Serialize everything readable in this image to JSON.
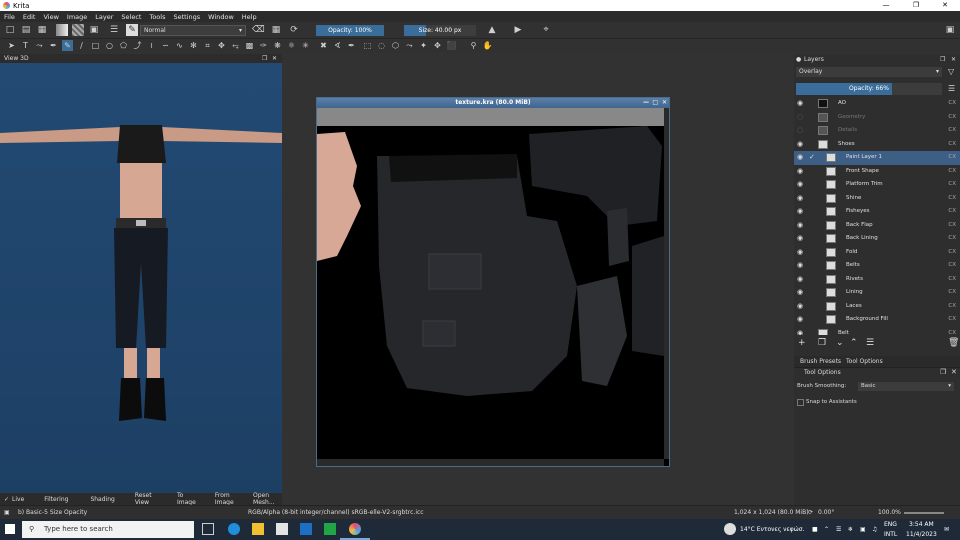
{
  "window": {
    "title": "Krita"
  },
  "menubar": [
    "File",
    "Edit",
    "View",
    "Image",
    "Layer",
    "Select",
    "Tools",
    "Settings",
    "Window",
    "Help"
  ],
  "toolbar": {
    "blend_mode": "Normal",
    "opacity_label": "Opacity: 100%",
    "opacity_value": 100,
    "size_label": "Size: 40.00 px",
    "size_fraction": 0.3
  },
  "view3d": {
    "title": "View 3D",
    "buttons": [
      "Live",
      "Filtering",
      "Shading",
      "Reset View",
      "To Image",
      "From Image",
      "Open Mesh..."
    ]
  },
  "document": {
    "title": "texture.kra (80.0 MiB)"
  },
  "layers": {
    "title": "Layers",
    "blend_mode": "Overlay",
    "opacity_label": "Opacity: 66%",
    "opacity_value": 66,
    "items": [
      {
        "name": "AO",
        "visible": true,
        "selected": false,
        "indent": 0,
        "thumb": "dark"
      },
      {
        "name": "Geometry",
        "visible": false,
        "selected": false,
        "indent": 0,
        "thumb": "gray"
      },
      {
        "name": "Details",
        "visible": false,
        "selected": false,
        "indent": 0,
        "thumb": "gray"
      },
      {
        "name": "Shoes",
        "visible": true,
        "selected": false,
        "indent": 0,
        "thumb": "light"
      },
      {
        "name": "Paint Layer 1",
        "visible": true,
        "selected": true,
        "indent": 1,
        "thumb": "light"
      },
      {
        "name": "Front Shape",
        "visible": true,
        "selected": false,
        "indent": 1,
        "thumb": "light"
      },
      {
        "name": "Platform Trim",
        "visible": true,
        "selected": false,
        "indent": 1,
        "thumb": "light"
      },
      {
        "name": "Shine",
        "visible": true,
        "selected": false,
        "indent": 1,
        "thumb": "light"
      },
      {
        "name": "Fisheyes",
        "visible": true,
        "selected": false,
        "indent": 1,
        "thumb": "light"
      },
      {
        "name": "Back Flap",
        "visible": true,
        "selected": false,
        "indent": 1,
        "thumb": "light"
      },
      {
        "name": "Back Lining",
        "visible": true,
        "selected": false,
        "indent": 1,
        "thumb": "light"
      },
      {
        "name": "Fold",
        "visible": true,
        "selected": false,
        "indent": 1,
        "thumb": "light"
      },
      {
        "name": "Belts",
        "visible": true,
        "selected": false,
        "indent": 1,
        "thumb": "light"
      },
      {
        "name": "Rivets",
        "visible": true,
        "selected": false,
        "indent": 1,
        "thumb": "light"
      },
      {
        "name": "Lining",
        "visible": true,
        "selected": false,
        "indent": 1,
        "thumb": "light"
      },
      {
        "name": "Laces",
        "visible": true,
        "selected": false,
        "indent": 1,
        "thumb": "light"
      },
      {
        "name": "Background Fill",
        "visible": true,
        "selected": false,
        "indent": 1,
        "thumb": "light"
      },
      {
        "name": "Belt",
        "visible": true,
        "selected": false,
        "indent": 0,
        "thumb": "light"
      }
    ],
    "props_label": "CX"
  },
  "panel_tabs": [
    "Brush Presets",
    "Tool Options"
  ],
  "tool_options": {
    "title": "Tool Options",
    "smoothing_label": "Brush Smoothing:",
    "smoothing_value": "Basic",
    "snap_label": "Snap to Assistants"
  },
  "statusbar": {
    "brush": "b) Basic-5 Size Opacity",
    "color_info": "RGB/Alpha (8-bit integer/channel)  sRGB-elle-V2-srgbtrc.icc",
    "dimensions": "1,024 x 1,024 (80.0 MiB)",
    "rotation": "0.00°",
    "zoom": "100.0%"
  },
  "taskbar": {
    "search_placeholder": "Type here to search",
    "weather": "14°C  Εντονες νεφώσ.",
    "lang": "ENG",
    "lang2": "INTL",
    "time": "3:54 AM",
    "date": "11/4/2023"
  },
  "colors": {
    "accent": "#3a6d99",
    "selected": "#3d5f86",
    "viewport": "#224a73"
  }
}
